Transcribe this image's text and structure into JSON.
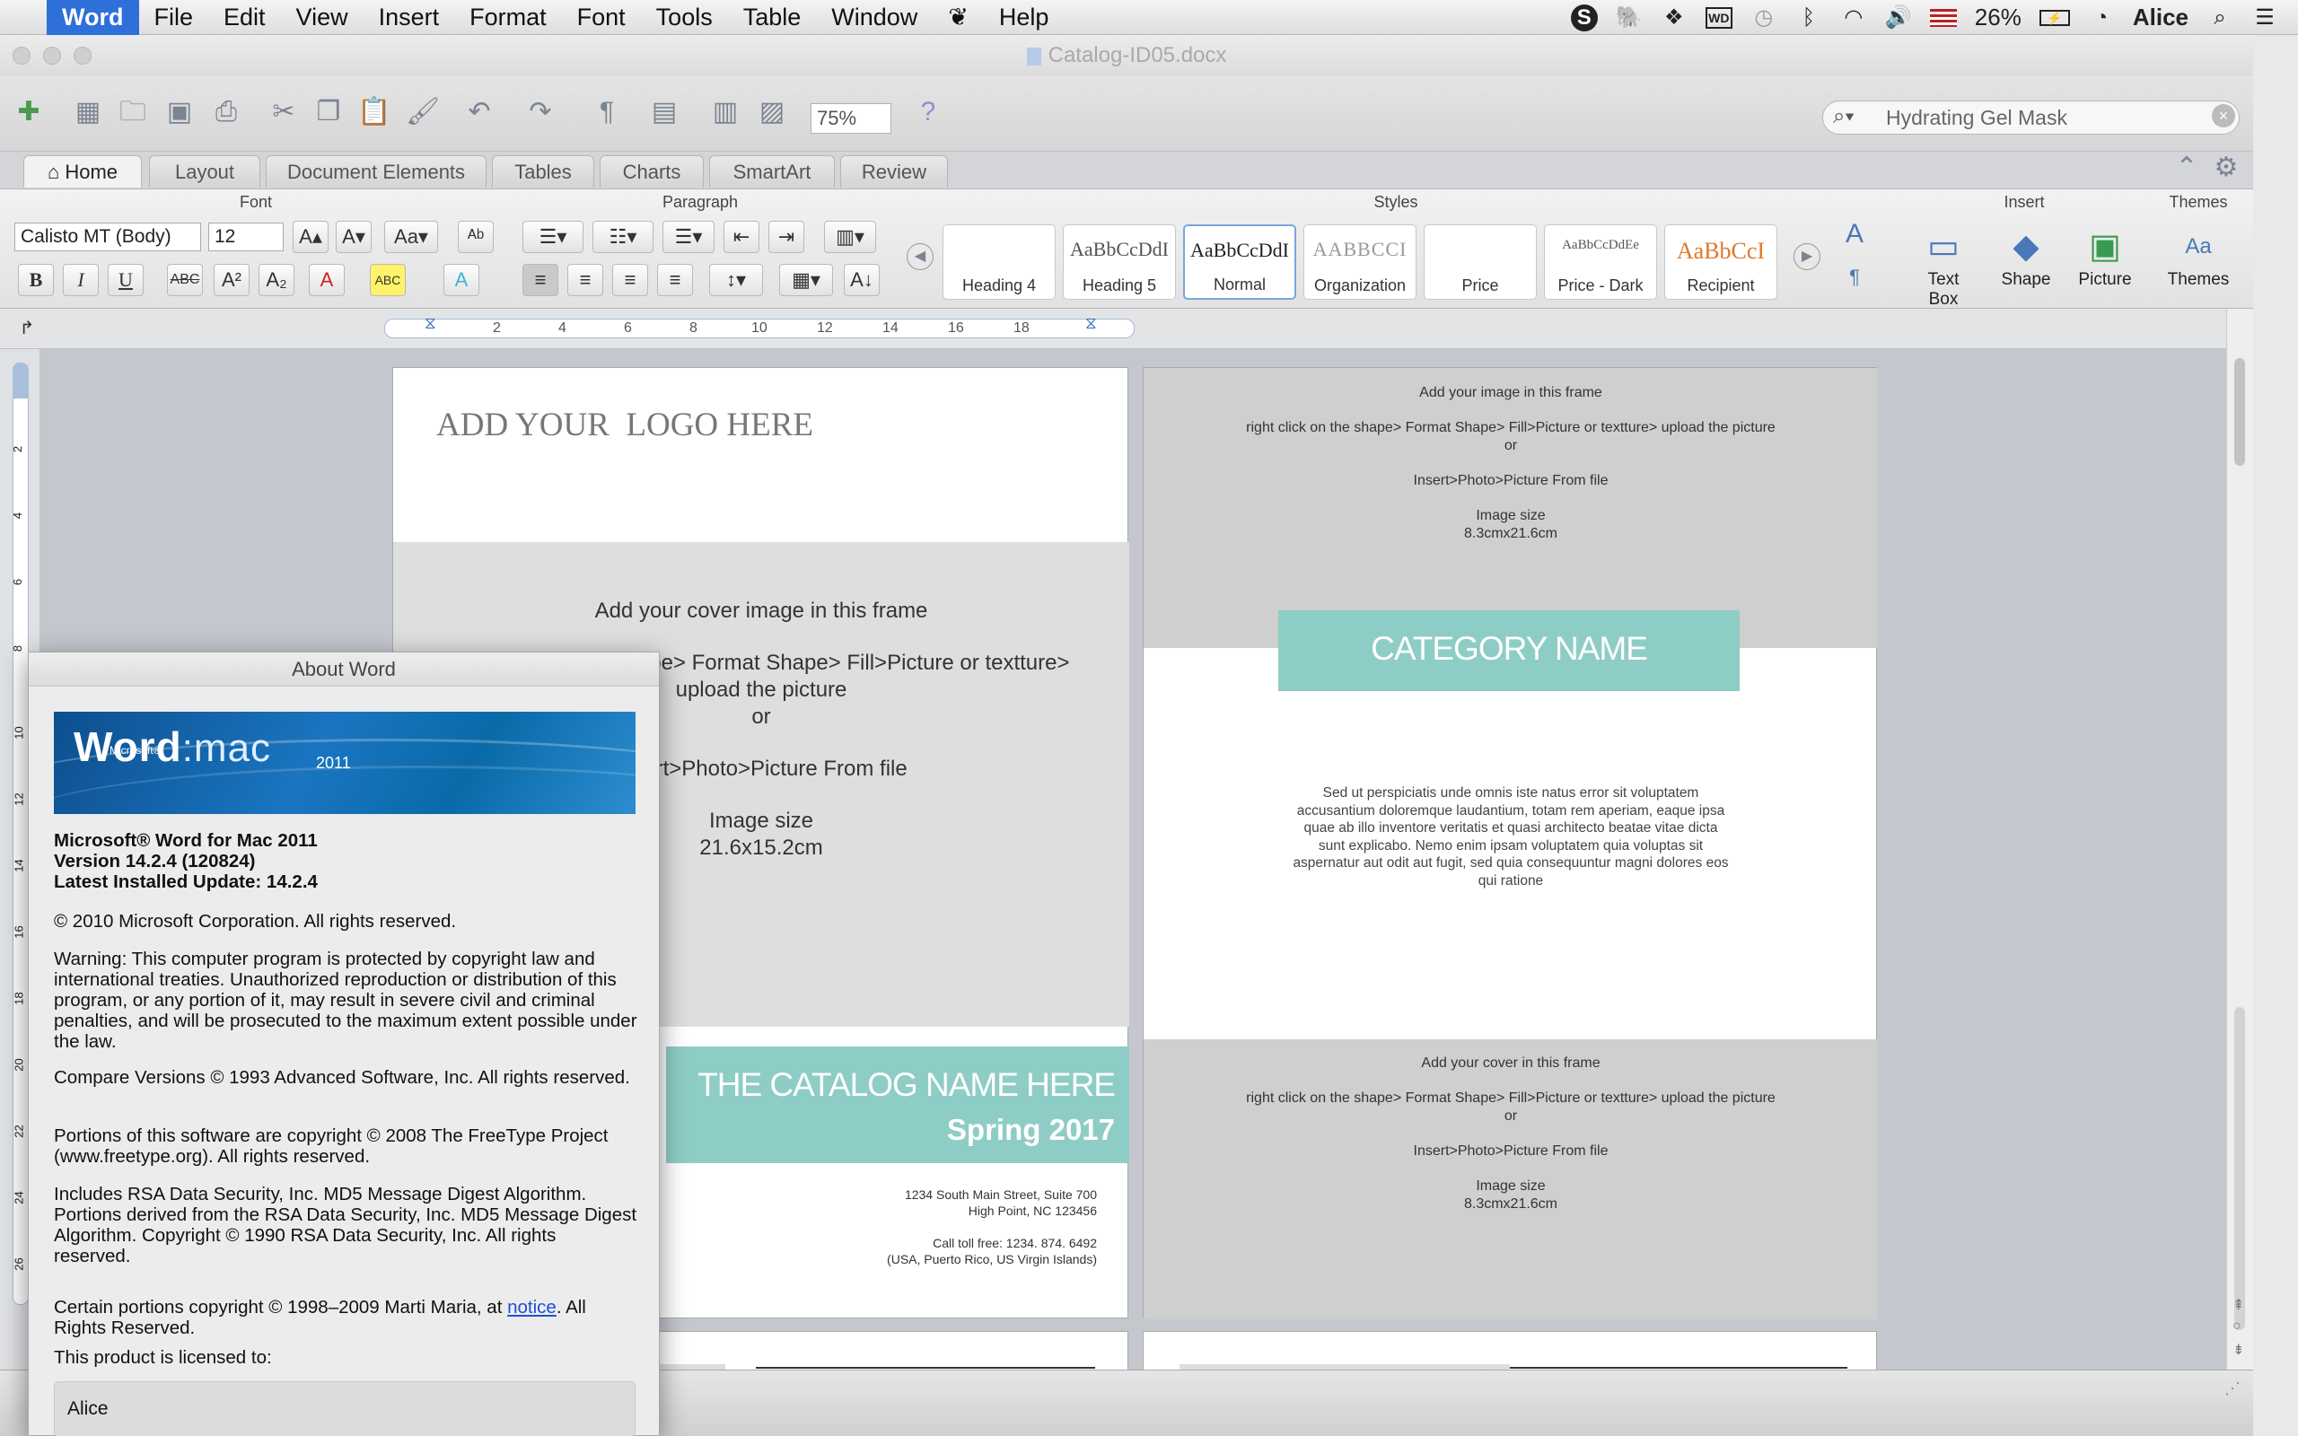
{
  "menubar": {
    "app_name": "Word",
    "items": [
      "File",
      "Edit",
      "View",
      "Insert",
      "Format",
      "Font",
      "Tools",
      "Table",
      "Window",
      "Help"
    ],
    "battery": "26%",
    "user": "Alice"
  },
  "window": {
    "title": "Catalog-ID05.docx"
  },
  "toolbar": {
    "zoom": "75%",
    "search_value": "Hydrating Gel Mask"
  },
  "ribbon_tabs": [
    "Home",
    "Layout",
    "Document Elements",
    "Tables",
    "Charts",
    "SmartArt",
    "Review"
  ],
  "ribbon": {
    "groups": {
      "font": "Font",
      "paragraph": "Paragraph",
      "styles": "Styles",
      "insert": "Insert",
      "themes": "Themes"
    },
    "font_name": "Calisto MT (Body)",
    "font_size": "12",
    "styles": [
      {
        "sample": "",
        "name": "Heading 4"
      },
      {
        "sample": "AaBbCcDdI",
        "name": "Heading 5"
      },
      {
        "sample": "AaBbCcDdI",
        "name": "Normal"
      },
      {
        "sample": "AABBCCI",
        "name": "Organization"
      },
      {
        "sample": "",
        "name": "Price"
      },
      {
        "sample": "AaBbCcDdEe",
        "name": "Price - Dark"
      },
      {
        "sample": "AaBbCcI",
        "name": "Recipient"
      }
    ],
    "insert": {
      "text_box": "Text Box",
      "shape": "Shape",
      "picture": "Picture"
    },
    "themes_label": "Themes"
  },
  "ruler": {
    "ticks": [
      "2",
      "4",
      "6",
      "8",
      "10",
      "12",
      "14",
      "16",
      "18"
    ]
  },
  "vruler": {
    "ticks": [
      "2",
      "4",
      "6",
      "8",
      "10",
      "12",
      "14",
      "16",
      "18",
      "20",
      "22",
      "24",
      "26"
    ]
  },
  "document": {
    "left_page": {
      "logo_text": "ADD YOUR  LOGO HERE",
      "cover_lines": [
        "Add your cover image in this frame",
        "right click on the shape> Format Shape> Fill>Picture or textture>",
        "upload the picture",
        "or",
        "Insert>Photo>Picture From file",
        "Image size",
        "21.6x15.2cm"
      ],
      "catalog_name": "THE CATALOG NAME HERE",
      "season": "Spring 2017",
      "address": [
        "1234 South Main Street, Suite 700",
        "High Point, NC 123456"
      ],
      "phone": [
        "Call toll free: 1234. 874. 6492",
        "(USA, Puerto Rico, US Virgin Islands)"
      ]
    },
    "right_page": {
      "top_lines": [
        "Add your image in this frame",
        "right click on the shape> Format Shape> Fill>Picture or textture> upload the picture",
        "or",
        "Insert>Photo>Picture From file",
        "Image size",
        "8.3cmx21.6cm"
      ],
      "category": "CATEGORY NAME",
      "body": "Sed ut perspiciatis unde omnis iste natus error sit voluptatem accusantium doloremque laudantium, totam rem aperiam, eaque ipsa quae ab illo inventore veritatis et quasi architecto beatae vitae dicta sunt explicabo. Nemo enim ipsam voluptatem quia voluptas sit aspernatur aut odit aut fugit, sed quia consequuntur magni dolores eos qui ratione",
      "bottom_lines": [
        "Add your cover  in this frame",
        "right click on the shape> Format Shape> Fill>Picture or textture> upload the picture",
        "or",
        "Insert>Photo>Picture From file",
        "Image size",
        "8.3cmx21.6cm"
      ]
    }
  },
  "about": {
    "title": "About Word",
    "banner": {
      "microsoft": "Microsoft®",
      "word": "Word",
      "mac": ":mac",
      "year": "2011"
    },
    "product": "Microsoft® Word for Mac 2011",
    "version": "Version 14.2.4 (120824)",
    "update": "Latest Installed Update: 14.2.4",
    "copyright": "© 2010 Microsoft Corporation. All rights reserved.",
    "warning": "Warning: This computer program is protected by copyright law and international treaties.  Unauthorized reproduction or distribution of this program, or any portion of it, may result in severe civil and criminal penalties, and will be prosecuted to the maximum extent possible under the law.",
    "compare": "Compare Versions © 1993 Advanced Software, Inc.  All rights reserved.",
    "freetype": "Portions of this software are copyright © 2008 The FreeType Project (www.freetype.org).  All rights reserved.",
    "rsa": "Includes RSA Data Security, Inc. MD5 Message Digest Algorithm.  Portions derived from the RSA Data Security, Inc. MD5 Message Digest Algorithm.  Copyright © 1990 RSA Data Security, Inc. All rights reserved.",
    "marti_prefix": "Certain portions copyright © 1998–2009  Marti Maria, at ",
    "marti_link": "notice",
    "marti_suffix": ".  All Rights Reserved.",
    "licensed_label": "This product is licensed to:",
    "licensed_to": "Alice"
  },
  "colors": {
    "teal": "#8ecdc5",
    "menu_highlight": "#2e6fd9",
    "link": "#1f4fd6"
  }
}
